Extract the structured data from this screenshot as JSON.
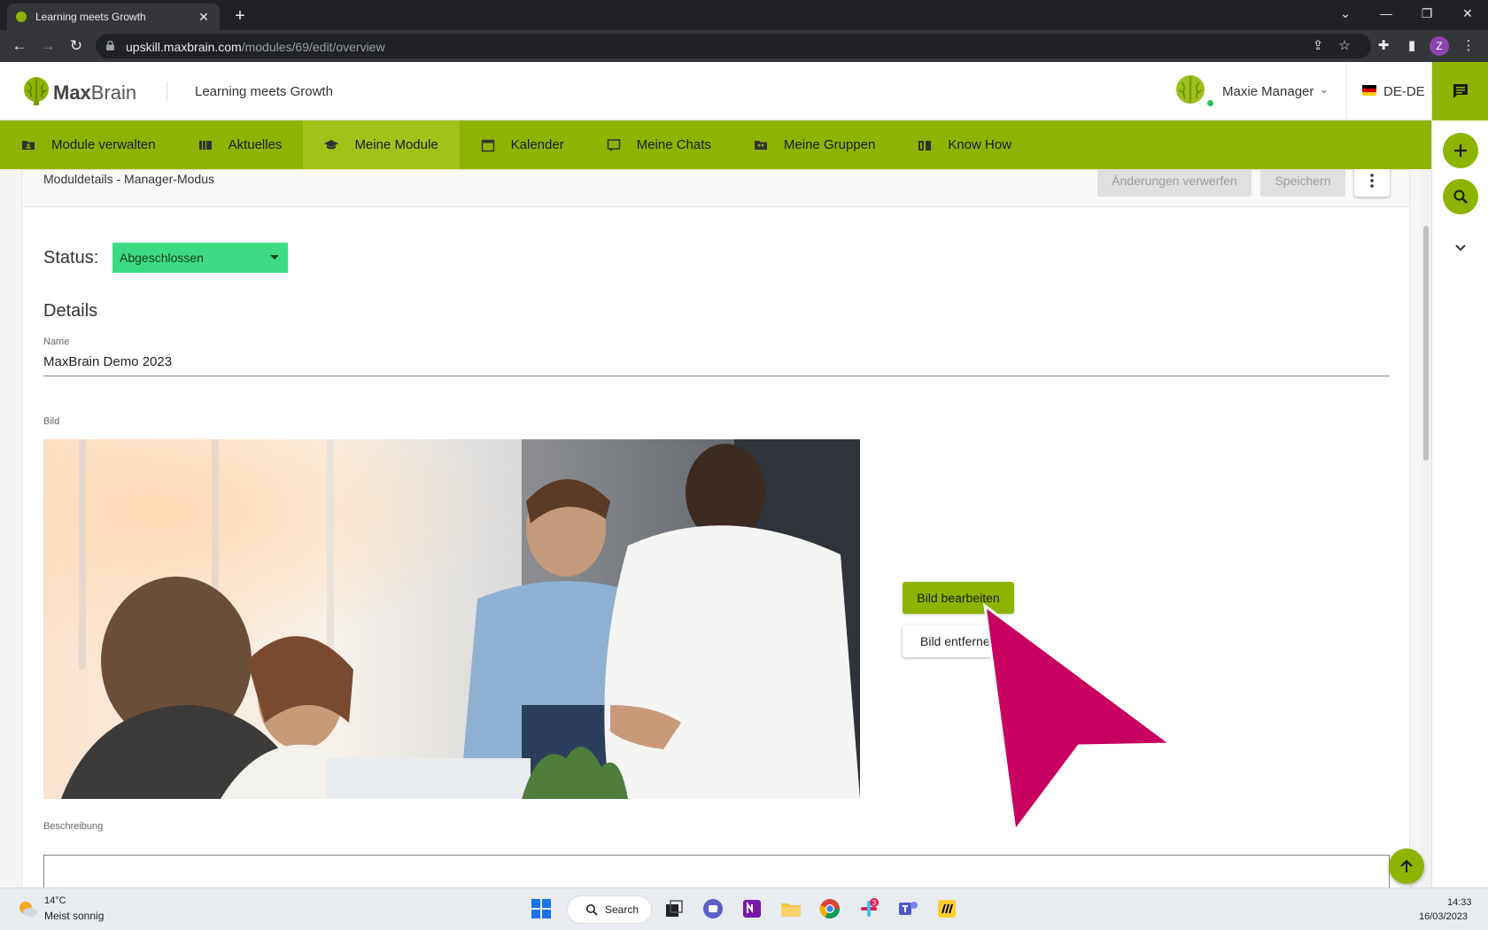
{
  "browser": {
    "tab_title": "Learning meets Growth",
    "url_host": "upskill.maxbrain.com",
    "url_path": "/modules/69/edit/overview",
    "profile_initial": "Z"
  },
  "header": {
    "logo_bold": "Max",
    "logo_light": "Brain",
    "tagline": "Learning meets Growth",
    "user_name": "Maxie Manager",
    "language": "DE-DE"
  },
  "nav": {
    "items": [
      {
        "label": "Module verwalten",
        "icon": "folder-person-icon"
      },
      {
        "label": "Aktuelles",
        "icon": "newspaper-icon"
      },
      {
        "label": "Meine Module",
        "icon": "graduation-cap-icon"
      },
      {
        "label": "Kalender",
        "icon": "calendar-icon"
      },
      {
        "label": "Meine Chats",
        "icon": "chat-icon"
      },
      {
        "label": "Meine Gruppen",
        "icon": "group-icon"
      },
      {
        "label": "Know How",
        "icon": "book-icon"
      }
    ],
    "active_index": 2
  },
  "card": {
    "title": "Moduldetails - Manager-Modus",
    "discard_label": "Änderungen verwerfen",
    "save_label": "Speichern"
  },
  "form": {
    "status_label": "Status:",
    "status_value": "Abgeschlossen",
    "section_title": "Details",
    "name_label": "Name",
    "name_value": "MaxBrain Demo 2023",
    "image_label": "Bild",
    "edit_image_label": "Bild bearbeiten",
    "remove_image_label": "Bild entfernen",
    "description_label": "Beschreibung"
  },
  "taskbar": {
    "temperature": "14°C",
    "weather": "Meist sonnig",
    "search_label": "Search",
    "time": "14:33",
    "date": "16/03/2023",
    "slack_badge": "3"
  },
  "colors": {
    "brand_green": "#8db400",
    "status_green": "#3ddc84",
    "pointer_magenta": "#c8005f"
  }
}
